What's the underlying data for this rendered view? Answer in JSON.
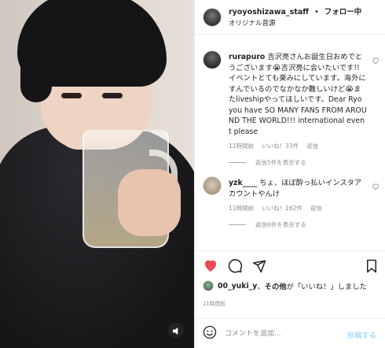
{
  "header": {
    "username": "ryoyoshizawa_staff",
    "separator": "•",
    "follow_label": "フォロー中",
    "audio_label": "オリジナル音源"
  },
  "comments": [
    {
      "username": "rurapuro",
      "text": "吉沢亮さんお誕生日おめでとうございます😭吉沢亮に会いたいです!!イベントとても楽みにしています。海外にすんでいるのでなかなか難しいけど😭またliveshipやってほしいです。Dear Ryo you have SO MANY FANS FROM AROUND THE WORLD!!! international event please",
      "time": "11時間前",
      "likes": "いいね！33件",
      "reply_label": "返信",
      "view_replies": "返信5件を表示する"
    },
    {
      "username": "yzk____",
      "text": "ちょ、ほぼ酔っ払いインスタアカウントやんけ",
      "time": "11時間前",
      "likes": "いいね！162件",
      "reply_label": "返信",
      "view_replies": "返信6件を表示する"
    }
  ],
  "likes_summary": {
    "user": "00_yuki_y",
    "middle": "、",
    "others": "その他",
    "suffix": "が「いいね！」しました"
  },
  "post_time": "11時間前",
  "composer": {
    "placeholder": "コメントを追加...",
    "post_label": "投稿する"
  },
  "colors": {
    "like_red": "#ed4956",
    "post_blue": "#b2dffc",
    "muted": "#8e8e8e"
  },
  "icons": {
    "like": "heart-icon",
    "comment": "comment-icon",
    "share": "paper-plane-icon",
    "save": "bookmark-icon",
    "emoji": "smiley-icon",
    "mute": "speaker-icon"
  }
}
